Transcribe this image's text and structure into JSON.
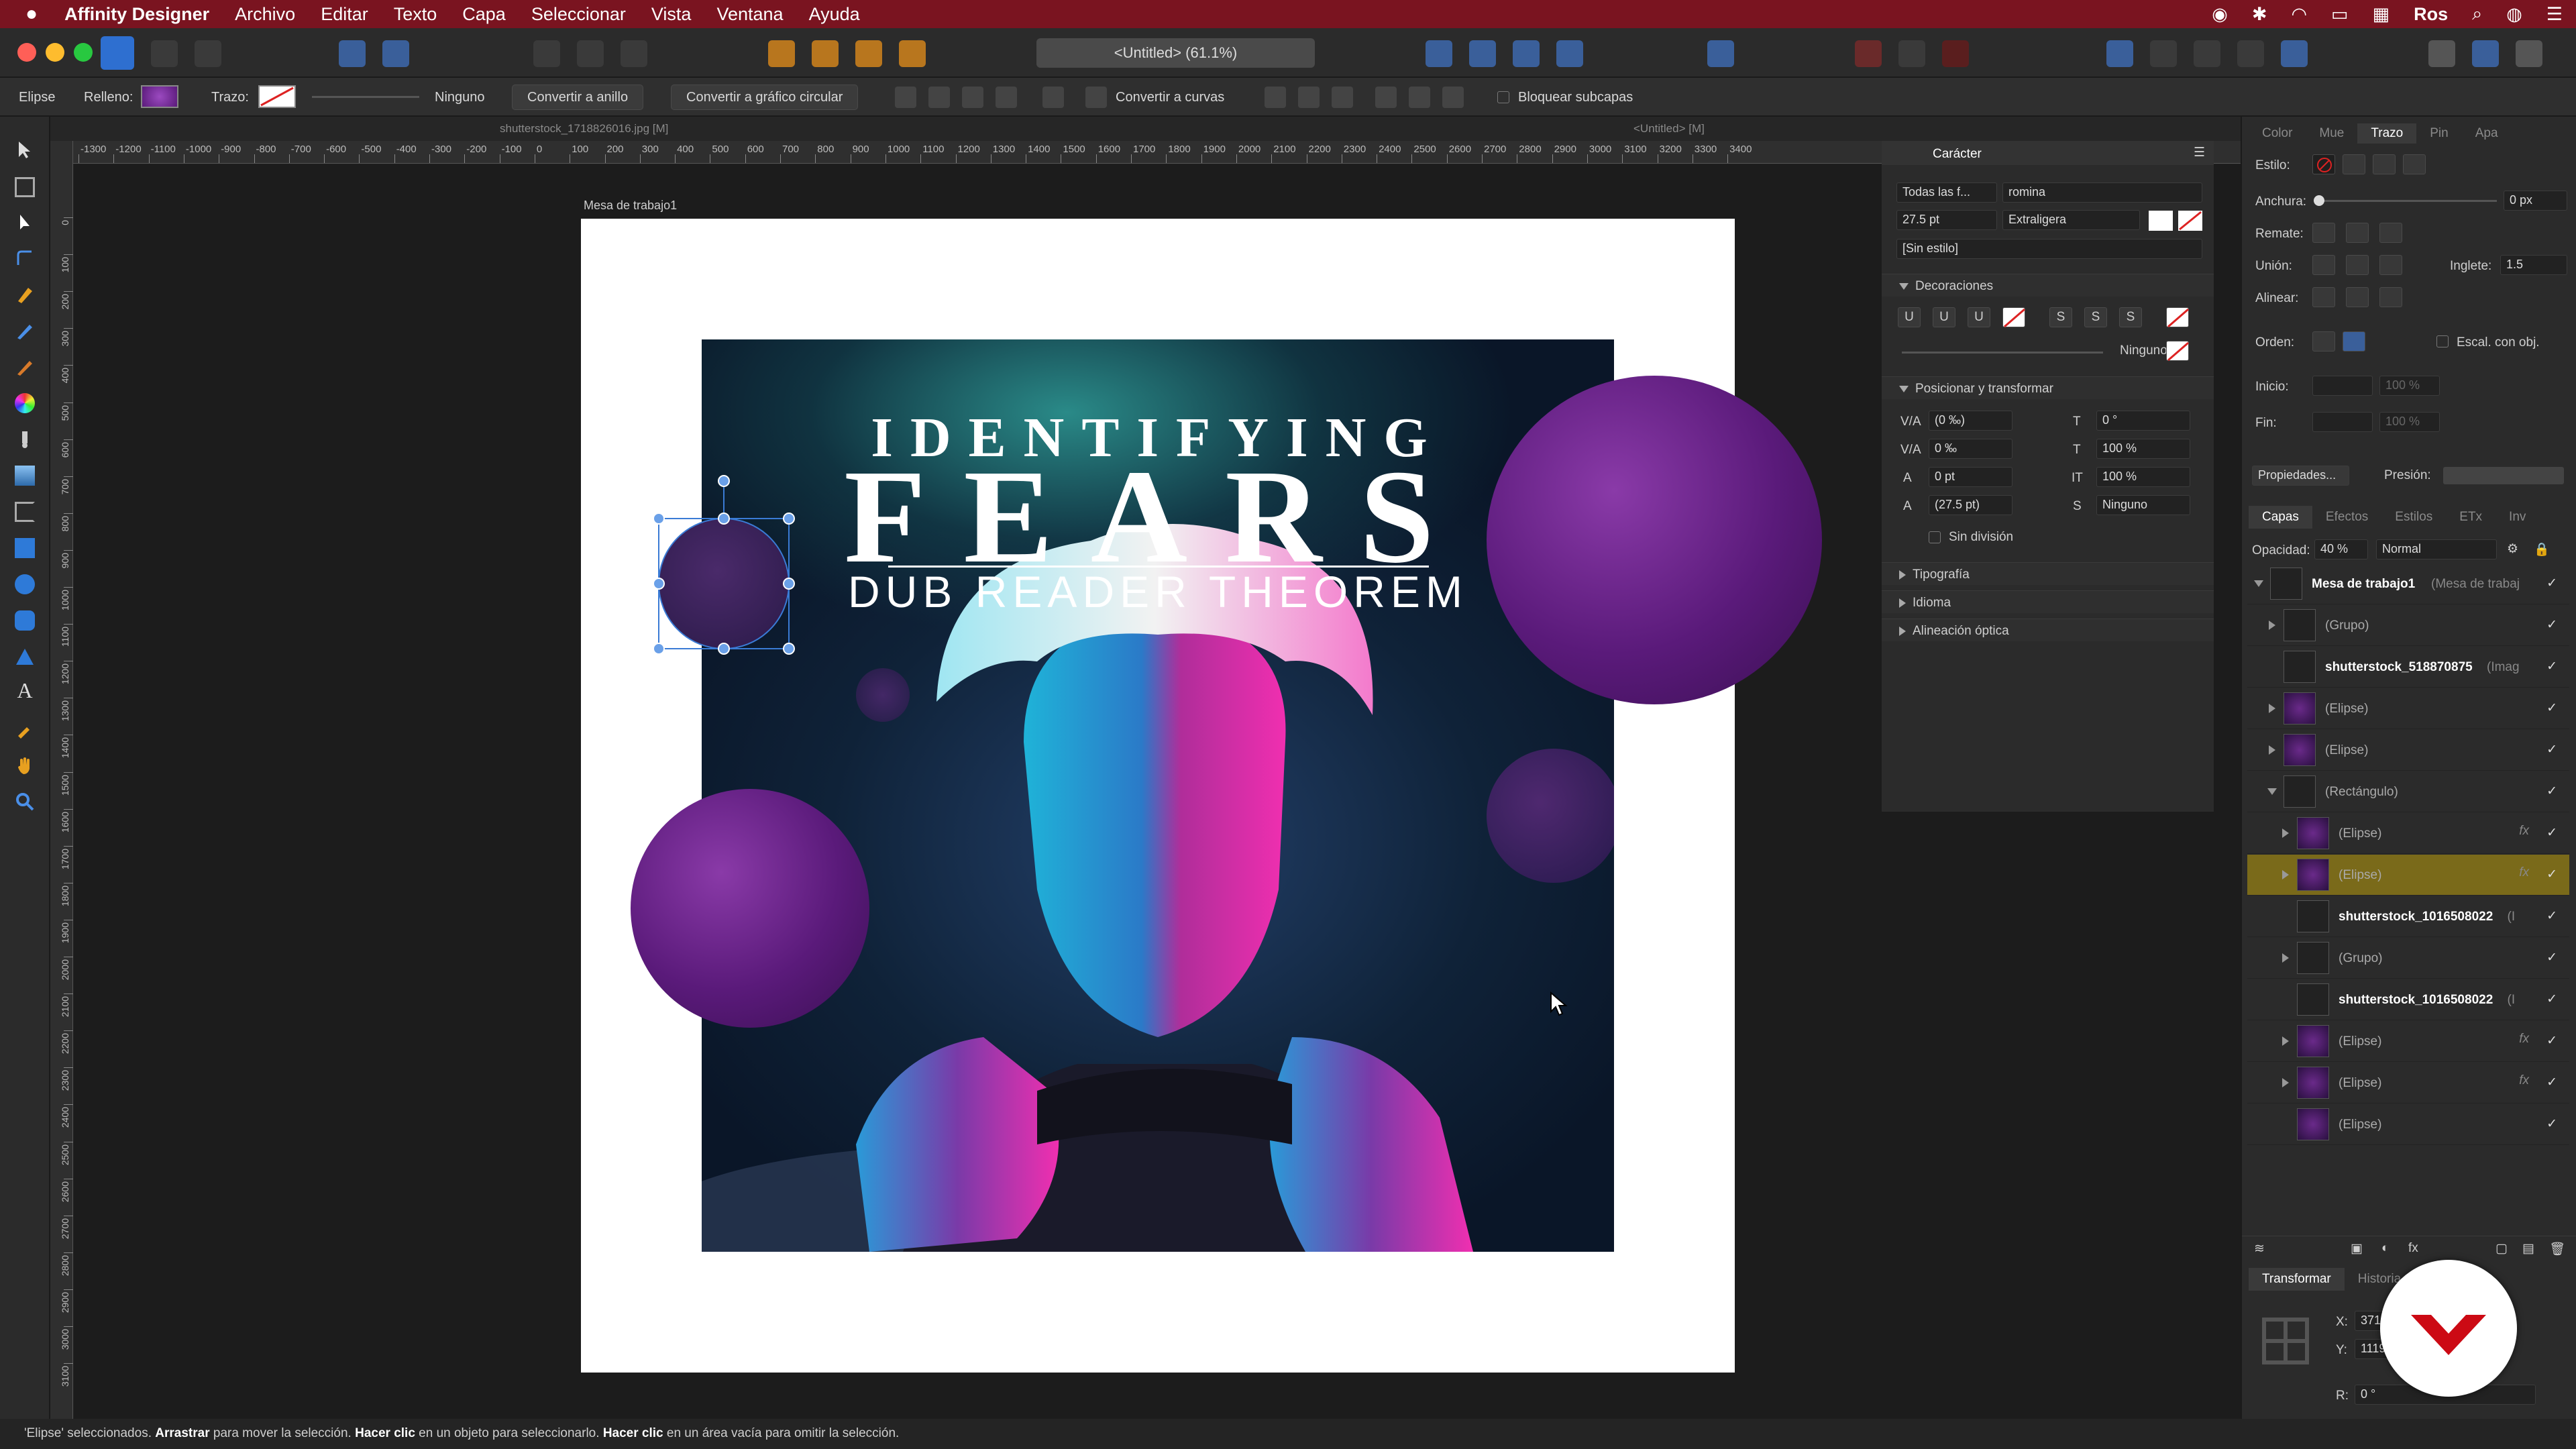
{
  "menubar": {
    "app_name": "Affinity Designer",
    "items": [
      "Archivo",
      "Editar",
      "Texto",
      "Capa",
      "Seleccionar",
      "Vista",
      "Ventana",
      "Ayuda"
    ],
    "user": "Ros"
  },
  "toolbar": {
    "document_title": "<Untitled> (61.1%)"
  },
  "context_bar": {
    "shape_label": "Elipse",
    "fill_label": "Relleno:",
    "stroke_label": "Trazo:",
    "stroke_value": "Ninguno",
    "convert_ring": "Convertir a anillo",
    "convert_pie": "Convertir a gráfico circular",
    "convert_curves": "Convertir a curvas",
    "lock_children": "Bloquear subcapas",
    "fill_color": "#7b2a9a"
  },
  "doc_tabs": {
    "left": "shutterstock_1718826016.jpg [M]",
    "right": "<Untitled> [M]"
  },
  "ruler": {
    "unit": "px",
    "h_ticks": [
      "-1300",
      "-1200",
      "-1100",
      "-1000",
      "-900",
      "-800",
      "-700",
      "-600",
      "-500",
      "-400",
      "-300",
      "-200",
      "-100",
      "0",
      "100",
      "200",
      "300",
      "400",
      "500",
      "600",
      "700",
      "800",
      "900",
      "1000",
      "1100",
      "1200",
      "1300",
      "1400",
      "1500",
      "1600",
      "1700",
      "1800",
      "1900",
      "2000",
      "2100",
      "2200",
      "2300",
      "2400",
      "2500",
      "2600",
      "2700",
      "2800",
      "2900",
      "3000",
      "3100",
      "3200",
      "3300",
      "3400"
    ],
    "v_ticks": [
      "0",
      "100",
      "200",
      "300",
      "400",
      "500",
      "600",
      "700",
      "800",
      "900",
      "1000",
      "1100",
      "1200",
      "1300",
      "1400",
      "1500",
      "1600",
      "1700",
      "1800",
      "1900",
      "2000",
      "2100",
      "2200",
      "2300",
      "2400",
      "2500",
      "2600",
      "2700",
      "2800",
      "2900",
      "3000",
      "3100"
    ]
  },
  "artboard": {
    "label": "Mesa de trabajo1",
    "poster": {
      "line1": "IDENTIFYING",
      "line2": "FEARS",
      "line3": "DUB READER THEOREM"
    }
  },
  "character_panel": {
    "title": "Carácter",
    "font_collection": "Todas las f...",
    "font_name": "romina",
    "font_size": "27.5 pt",
    "font_weight": "Extraligera",
    "style": "[Sin estilo]",
    "decorations_title": "Decoraciones",
    "decoration_none": "Ninguno",
    "decor_glyphs": [
      "U",
      "U",
      "U",
      "S",
      "S",
      "S"
    ],
    "position_title": "Posicionar y transformar",
    "kerning": "(0 ‰)",
    "tracking": "0 ‰",
    "baseline": "0 pt",
    "leading": "(27.5 pt)",
    "shear": "0 °",
    "scale_h": "100 %",
    "scale_v": "100 %",
    "sub_none": "Ninguno",
    "no_break": "Sin división",
    "typography": "Tipografía",
    "language": "Idioma",
    "optical": "Alineación óptica"
  },
  "stroke_panel": {
    "tabs": [
      "Color",
      "Mue",
      "Trazo",
      "Pin",
      "Apa"
    ],
    "active_tab": "Trazo",
    "style_label": "Estilo:",
    "width_label": "Anchura:",
    "width_value": "0 px",
    "cap_label": "Remate:",
    "join_label": "Unión:",
    "miter_label": "Inglete:",
    "miter_value": "1.5",
    "align_label": "Alinear:",
    "order_label": "Orden:",
    "scale_label": "Escal. con obj.",
    "start_label": "Inicio:",
    "end_label": "Fin:",
    "arrow_pct": "100 %",
    "properties": "Propiedades...",
    "pressure": "Presión:"
  },
  "layers_panel": {
    "tabs": [
      "Capas",
      "Efectos",
      "Estilos",
      "ETx",
      "Inv"
    ],
    "active_tab": "Capas",
    "opacity_label": "Opacidad:",
    "opacity": "40 %",
    "blend": "Normal",
    "rows": [
      {
        "name": "Mesa de trabajo1",
        "suffix": "(Mesa de trabaj",
        "bold": true,
        "indent": 0,
        "expanded": true
      },
      {
        "name": "(Grupo)",
        "suffix": "",
        "bold": false,
        "indent": 1,
        "expand": true
      },
      {
        "name": "shutterstock_518870875",
        "suffix": "(Imag",
        "bold": true,
        "indent": 1
      },
      {
        "name": "(Elipse)",
        "suffix": "",
        "bold": false,
        "indent": 1,
        "expand": true
      },
      {
        "name": "(Elipse)",
        "suffix": "",
        "bold": false,
        "indent": 1,
        "expand": true
      },
      {
        "name": "(Rectángulo)",
        "suffix": "",
        "bold": false,
        "indent": 1,
        "expanded": true
      },
      {
        "name": "(Elipse)",
        "suffix": "",
        "bold": false,
        "indent": 2,
        "expand": true,
        "fx": true
      },
      {
        "name": "(Elipse)",
        "suffix": "",
        "bold": false,
        "indent": 2,
        "expand": true,
        "fx": true,
        "selected": true
      },
      {
        "name": "shutterstock_1016508022",
        "suffix": "(I",
        "bold": true,
        "indent": 2
      },
      {
        "name": "(Grupo)",
        "suffix": "",
        "bold": false,
        "indent": 2,
        "expand": true
      },
      {
        "name": "shutterstock_1016508022",
        "suffix": "(I",
        "bold": true,
        "indent": 2
      },
      {
        "name": "(Elipse)",
        "suffix": "",
        "bold": false,
        "indent": 2,
        "expand": true,
        "fx": true
      },
      {
        "name": "(Elipse)",
        "suffix": "",
        "bold": false,
        "indent": 2,
        "expand": true,
        "fx": true
      },
      {
        "name": "(Elipse)",
        "suffix": "",
        "bold": false,
        "indent": 2
      }
    ]
  },
  "transform_panel": {
    "tabs": [
      "Transformar",
      "Historia"
    ],
    "x_label": "X:",
    "x_value": "371,",
    "y_label": "Y:",
    "y_value": "1119",
    "r_label": "R:",
    "r_value": "0 °"
  },
  "status": {
    "part1": "'Elipse' seleccionados. ",
    "b1": "Arrastrar",
    "part2": " para mover la selección. ",
    "b2": "Hacer clic",
    "part3": " en un objeto para seleccionarlo. ",
    "b3": "Hacer clic",
    "part4": " en un área vacía para omitir la selección."
  },
  "colors": {
    "menubar": "#7a1420",
    "accent": "#3a7bd5",
    "purple": "#7b2a9a",
    "selected_row": "#7a6a1a"
  }
}
